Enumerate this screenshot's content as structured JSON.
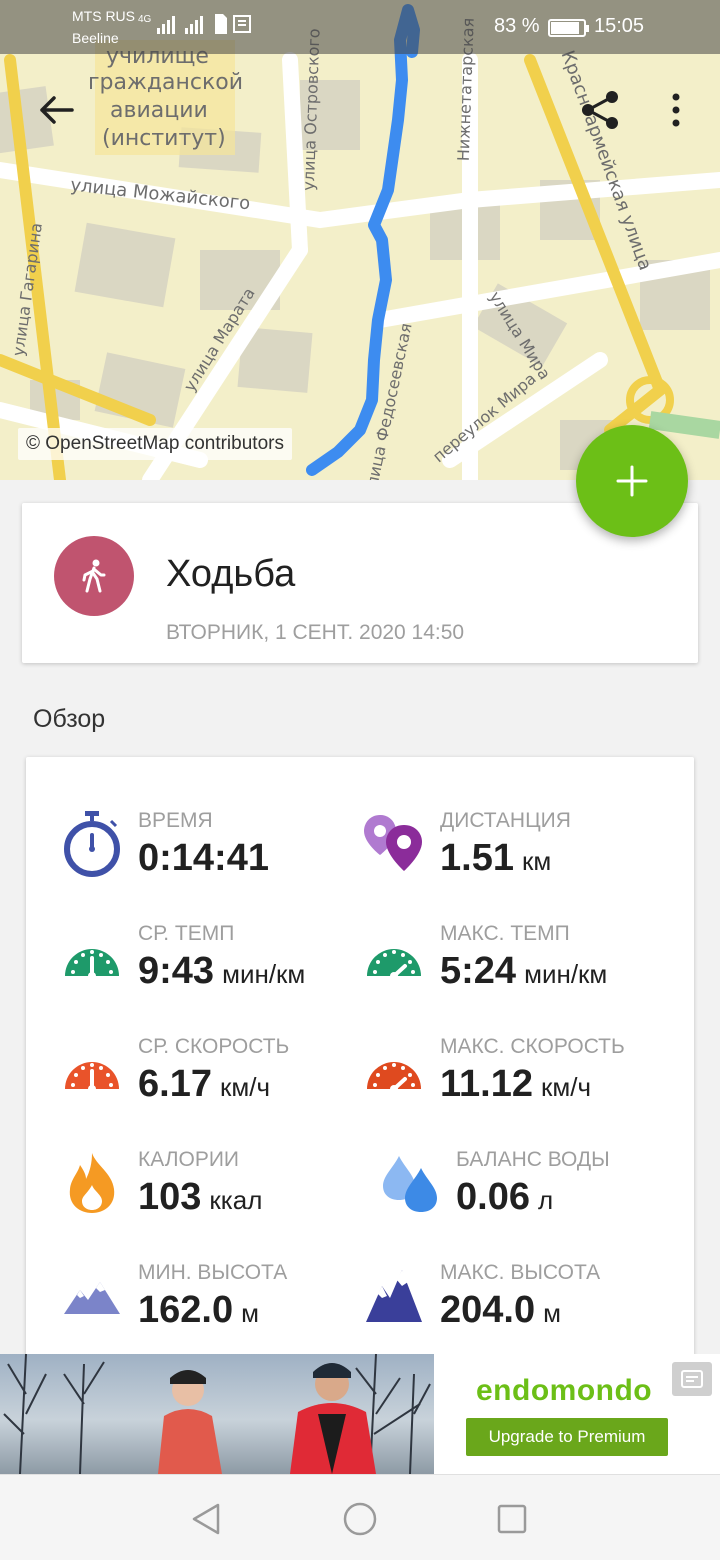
{
  "status_bar": {
    "carrier_1": "MTS RUS",
    "carrier_2": "Beeline",
    "network": "4G",
    "battery": "83 %",
    "time": "15:05"
  },
  "map": {
    "credit": "© OpenStreetMap contributors",
    "streets": [
      "училище",
      "гражданской",
      "авиации",
      "(институт)",
      "улица Можайского",
      "улица Островского",
      "Нижнетатарская",
      "Красноармейская улица",
      "улица Гагарина",
      "улица Марата",
      "улица Федосеевская",
      "улица Мира",
      "переулок Мира"
    ],
    "route_color": "#3d8cf0"
  },
  "actions": {
    "back_icon": "arrow-left-icon",
    "share_icon": "share-icon",
    "more_icon": "more-vertical-icon",
    "fab_icon": "plus-icon"
  },
  "activity": {
    "title": "Ходьба",
    "date": "ВТОРНИК, 1 СЕНТ. 2020 14:50",
    "avatar_color": "#c0546f",
    "sport_icon": "walking-icon"
  },
  "section_title": "Обзор",
  "stats": [
    {
      "label": "ВРЕМЯ",
      "value": "0:14:41",
      "unit": "",
      "icon": "stopwatch-icon"
    },
    {
      "label": "ДИСТАНЦИЯ",
      "value": "1.51",
      "unit": "км",
      "icon": "location-pins-icon"
    },
    {
      "label": "СР. ТЕМП",
      "value": "9:43",
      "unit": "мин/км",
      "icon": "pace-gauge-icon"
    },
    {
      "label": "МАКС. ТЕМП",
      "value": "5:24",
      "unit": "мин/км",
      "icon": "max-pace-gauge-icon"
    },
    {
      "label": "СР. СКОРОСТЬ",
      "value": "6.17",
      "unit": "км/ч",
      "icon": "speed-gauge-icon"
    },
    {
      "label": "МАКС. СКОРОСТЬ",
      "value": "11.12",
      "unit": "км/ч",
      "icon": "max-speed-gauge-icon"
    },
    {
      "label": "КАЛОРИИ",
      "value": "103",
      "unit": "ккал",
      "icon": "flame-icon"
    },
    {
      "label": "БАЛАНС ВОДЫ",
      "value": "0.06",
      "unit": "л",
      "icon": "water-drops-icon"
    },
    {
      "label": "МИН. ВЫСОТА",
      "value": "162.0",
      "unit": "м",
      "icon": "mountain-icon"
    },
    {
      "label": "МАКС. ВЫСОТА",
      "value": "204.0",
      "unit": "м",
      "icon": "mountain-peak-icon"
    }
  ],
  "ad": {
    "brand": "endomondo",
    "cta": "Upgrade to Premium"
  },
  "nav": {
    "back": "nav-back-icon",
    "home": "nav-home-icon",
    "recents": "nav-recents-icon"
  }
}
